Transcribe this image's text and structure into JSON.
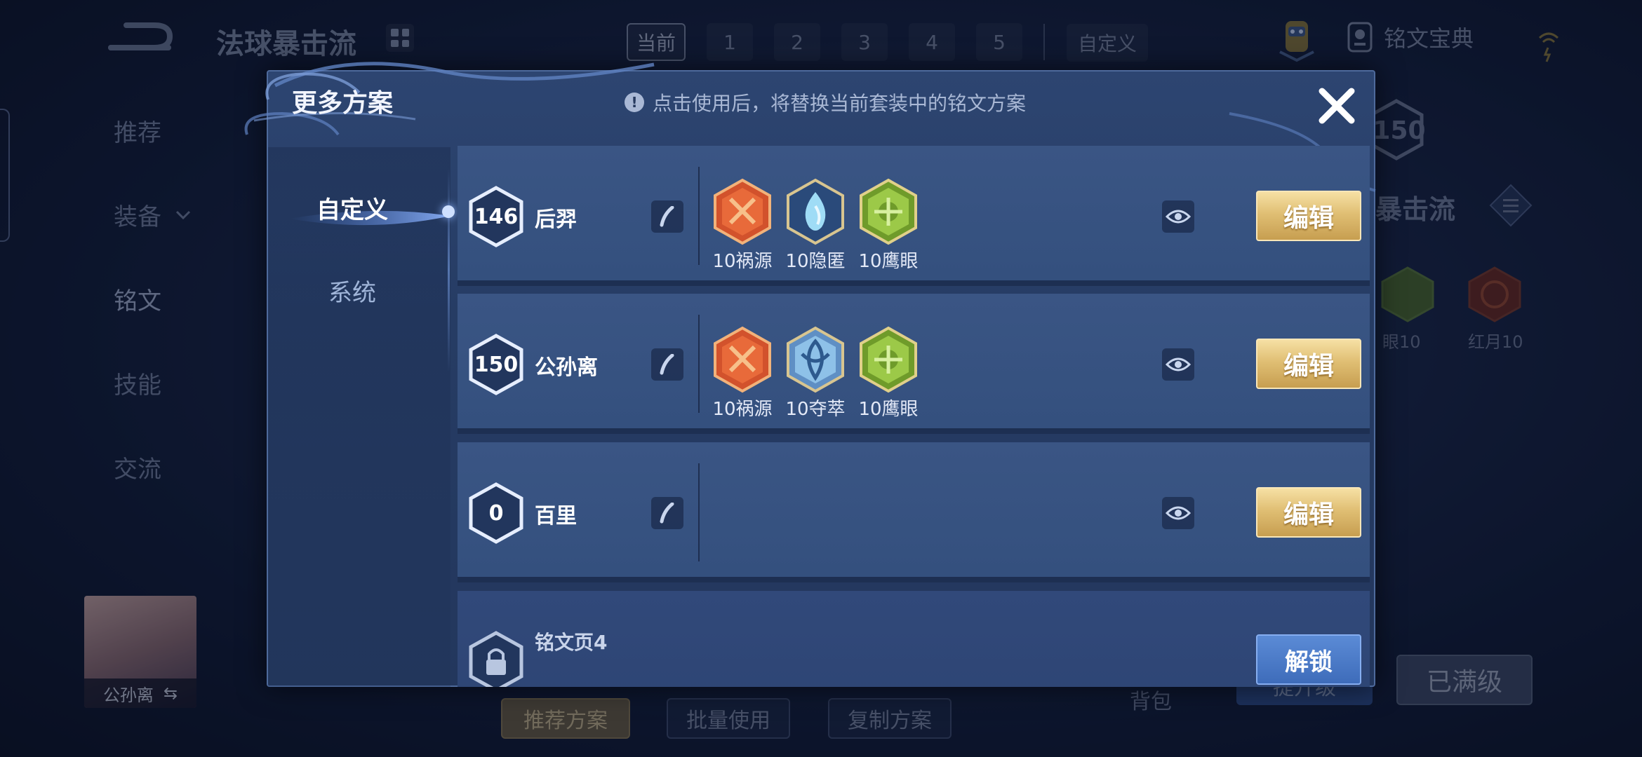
{
  "background": {
    "top_title": "法球暴击流",
    "page_tabs": [
      "当前",
      "1",
      "2",
      "3",
      "4",
      "5"
    ],
    "custom_tab": "自定义",
    "codex_label": "铭文宝典",
    "left_menu": [
      "推荐",
      "装备",
      "铭文",
      "技能",
      "交流"
    ],
    "right_level": "150",
    "right_title": "暴击流",
    "right_runes": [
      {
        "label": "眼10"
      },
      {
        "label": "红月10"
      }
    ],
    "hero_name": "公孙离",
    "bottom_buttons": [
      "推荐方案",
      "批量使用",
      "复制方案"
    ],
    "bag_label": "背包",
    "upgrade_label": "提升级",
    "maxed_label": "已满级"
  },
  "modal": {
    "title": "更多方案",
    "notice": "点击使用后，将替换当前套装中的铭文方案",
    "side_tabs": {
      "custom": "自定义",
      "system": "系统"
    },
    "plans": [
      {
        "level": "146",
        "name": "后羿",
        "runes": [
          {
            "label": "10祸源",
            "color": "red",
            "icon": "calamity-rune-icon"
          },
          {
            "label": "10隐匿",
            "color": "blue",
            "icon": "stealth-rune-icon"
          },
          {
            "label": "10鹰眼",
            "color": "green",
            "icon": "hawkeye-rune-icon"
          }
        ],
        "edit_label": "编辑"
      },
      {
        "level": "150",
        "name": "公孙离",
        "runes": [
          {
            "label": "10祸源",
            "color": "red",
            "icon": "calamity-rune-icon"
          },
          {
            "label": "10夺萃",
            "color": "blue",
            "icon": "plunder-rune-icon"
          },
          {
            "label": "10鹰眼",
            "color": "green",
            "icon": "hawkeye-rune-icon"
          }
        ],
        "edit_label": "编辑"
      },
      {
        "level": "0",
        "name": "百里",
        "runes": [],
        "edit_label": "编辑"
      }
    ],
    "locked_plan": {
      "name": "铭文页4",
      "unlock_label": "解锁"
    }
  },
  "colors": {
    "accent_gold": "#e0bf74",
    "accent_blue": "#3e6cba",
    "modal_bg": "#2d4571",
    "rune_red": "#d2522c",
    "rune_blue": "#7fc6ea",
    "rune_green": "#8fbf3a"
  }
}
